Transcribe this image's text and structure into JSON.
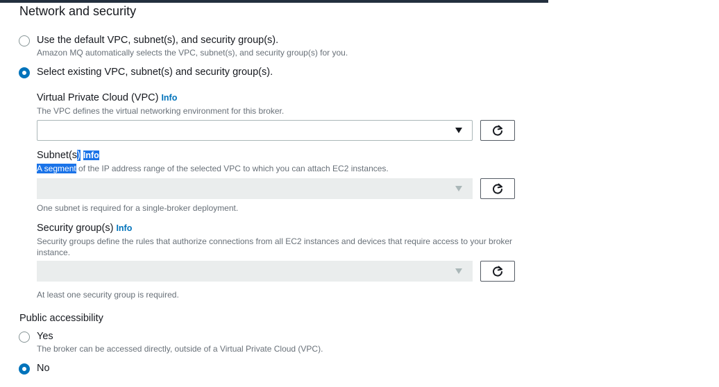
{
  "section": {
    "title": "Network and security"
  },
  "vpc_options": {
    "default": {
      "label": "Use the default VPC, subnet(s), and security group(s).",
      "description": "Amazon MQ automatically selects the VPC, subnet(s), and security group(s) for you.",
      "selected": false
    },
    "existing": {
      "label": "Select existing VPC, subnet(s) and security group(s).",
      "selected": true
    }
  },
  "vpc": {
    "label": "Virtual Private Cloud (VPC)",
    "info": "Info",
    "description": "The VPC defines the virtual networking environment for this broker.",
    "value": ""
  },
  "subnet": {
    "label_main": "Subnet(s",
    "label_tail": ")",
    "info": "Info",
    "description_highlight": "A segment",
    "description_rest": " of the IP address range of the selected VPC to which you can attach EC2 instances.",
    "hint": "One subnet is required for a single-broker deployment."
  },
  "security_groups": {
    "label": "Security group(s)",
    "info": "Info",
    "description": "Security groups define the rules that authorize connections from all EC2 instances and devices that require access to your broker instance.",
    "hint": "At least one security group is required."
  },
  "public_access": {
    "title": "Public accessibility",
    "yes_label": "Yes",
    "yes_description": "The broker can be accessed directly, outside of a Virtual Private Cloud (VPC).",
    "no_label": "No",
    "selected": "No"
  },
  "colors": {
    "accent": "#0073bb",
    "selection_highlight": "#1a73e8",
    "disabled_field": "#eaeded",
    "header_bar": "#232f3e"
  },
  "icons": {
    "refresh": "refresh-icon",
    "dropdown": "caret-down-icon"
  }
}
